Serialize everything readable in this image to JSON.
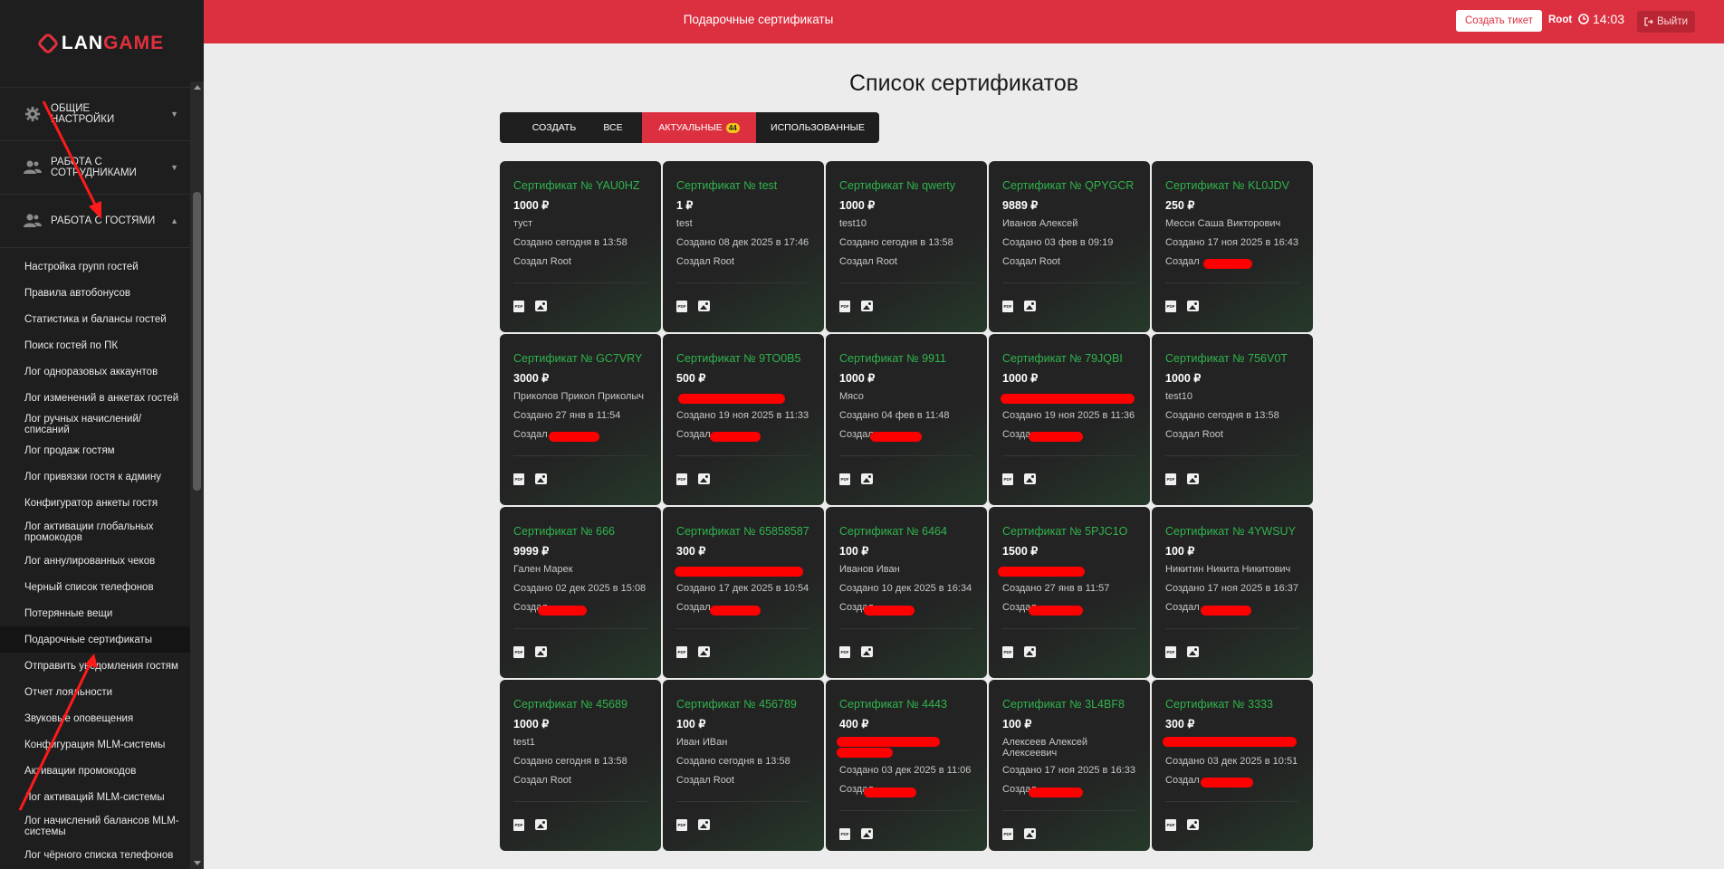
{
  "brand": {
    "lan": "LAN",
    "game": "GAME"
  },
  "sidebar": {
    "sections": [
      {
        "label": "Общие настройки",
        "icon": "gear-icon",
        "expanded": false
      },
      {
        "label": "Работа с сотрудниками",
        "icon": "users-icon",
        "expanded": false
      },
      {
        "label": "Работа с гостями",
        "icon": "users-icon",
        "expanded": true
      }
    ],
    "items": [
      "Настройка групп гостей",
      "Правила автобонусов",
      "Статистика и балансы гостей",
      "Поиск гостей по ПК",
      "Лог одноразовых аккаунтов",
      "Лог изменений в анкетах гостей",
      "Лог ручных начислений/списаний",
      "Лог продаж гостям",
      "Лог привязки гостя к админу",
      "Конфигуратор анкеты гостя",
      "Лог активации глобальных промокодов",
      "Лог аннулированных чеков",
      "Черный список телефонов",
      "Потерянные вещи",
      "Подарочные сертификаты",
      "Отправить уведомления гостям",
      "Отчет лояльности",
      "Звуковые оповещения",
      "Конфигурация MLM-системы",
      "Активации промокодов",
      "Лог активаций MLM-системы",
      "Лог начислений балансов MLM-системы",
      "Лог чёрного списка телефонов"
    ],
    "active_item": "Подарочные сертификаты"
  },
  "topbar": {
    "title": "Подарочные сертификаты",
    "ticket_button": "Создать тикет",
    "user": "Root",
    "time": "14:03",
    "logout": "Выйти"
  },
  "main": {
    "title": "Список сертификатов",
    "create_button": "Создать",
    "tabs": [
      {
        "label": "Все"
      },
      {
        "label": "Актуальные",
        "badge": "44",
        "active": true
      },
      {
        "label": "Использованные"
      }
    ]
  },
  "colors": {
    "accent": "#dc3040",
    "sidebar_bg": "#1e1e1e",
    "card_title": "#2fb44c"
  },
  "cards": [
    {
      "title": "Сертификат № YAU0HZ",
      "amount": "1000 ₽",
      "name": "туст",
      "created": "Создано сегодня в 13:58",
      "author": "Создал Root"
    },
    {
      "title": "Сертификат № test",
      "amount": "1 ₽",
      "name": "test",
      "created": "Создано 08 дек 2025 в 17:46",
      "author": "Создал Root"
    },
    {
      "title": "Сертификат № qwerty",
      "amount": "1000 ₽",
      "name": "test10",
      "created": "Создано сегодня в 13:58",
      "author": "Создал Root"
    },
    {
      "title": "Сертификат № QPYGCR",
      "amount": "9889 ₽",
      "name": "Иванов Алексей",
      "created": "Создано 03 фев в 09:19",
      "author": "Создал Root"
    },
    {
      "title": "Сертификат № KL0JDV",
      "amount": "250 ₽",
      "name": "Месси Саша Викторович",
      "created": "Создано 17 ноя 2025 в 16:43",
      "author": "Создал"
    },
    {
      "title": "Сертификат № GC7VRY",
      "amount": "3000 ₽",
      "name": "Приколов Прикол Приколыч",
      "created": "Создано 27 янв в 11:54",
      "author": "Создал"
    },
    {
      "title": "Сертификат № 9TO0B5",
      "amount": "500 ₽",
      "name": "",
      "created": "Создано 19 ноя 2025 в 11:33",
      "author": "Создал"
    },
    {
      "title": "Сертификат № 9911",
      "amount": "1000 ₽",
      "name": "Мясо",
      "created": "Создано 04 фев в 11:48",
      "author": "Создал"
    },
    {
      "title": "Сертификат № 79JQBI",
      "amount": "1000 ₽",
      "name": "",
      "created": "Создано 19 ноя 2025 в 11:36",
      "author": "Создал"
    },
    {
      "title": "Сертификат № 756V0T",
      "amount": "1000 ₽",
      "name": "test10",
      "created": "Создано сегодня в 13:58",
      "author": "Создал Root"
    },
    {
      "title": "Сертификат № 666",
      "amount": "9999 ₽",
      "name": "Гален Марек",
      "created": "Создано 02 дек 2025 в 15:08",
      "author": "Создал"
    },
    {
      "title": "Сертификат № 65858587",
      "amount": "300 ₽",
      "name": "",
      "created": "Создано 17 дек 2025 в 10:54",
      "author": "Создал"
    },
    {
      "title": "Сертификат № 6464",
      "amount": "100 ₽",
      "name": "Иванов Иван",
      "created": "Создано 10 дек 2025 в 16:34",
      "author": "Создал"
    },
    {
      "title": "Сертификат № 5PJC1O",
      "amount": "1500 ₽",
      "name": "",
      "created": "Создано 27 янв в 11:57",
      "author": "Создал"
    },
    {
      "title": "Сертификат № 4YWSUY",
      "amount": "100 ₽",
      "name": "Никитин Никита Никитович",
      "created": "Создано 17 ноя 2025 в 16:37",
      "author": "Создал"
    },
    {
      "title": "Сертификат № 45689",
      "amount": "1000 ₽",
      "name": "test1",
      "created": "Создано сегодня в 13:58",
      "author": "Создал Root"
    },
    {
      "title": "Сертификат № 456789",
      "amount": "100 ₽",
      "name": "Иван ИВан",
      "created": "Создано сегодня в 13:58",
      "author": "Создал Root"
    },
    {
      "title": "Сертификат № 4443",
      "amount": "400 ₽",
      "name": "",
      "created": "Создано 03 дек 2025 в 11:06",
      "author": "Создал"
    },
    {
      "title": "Сертификат № 3L4BF8",
      "amount": "100 ₽",
      "name": "Алексеев Алексей Алексеевич",
      "created": "Создано 17 ноя 2025 в 16:33",
      "author": "Создал"
    },
    {
      "title": "Сертификат № 3333",
      "amount": "300 ₽",
      "name": "",
      "created": "Создано 03 дек 2025 в 10:51",
      "author": "Создал"
    }
  ]
}
